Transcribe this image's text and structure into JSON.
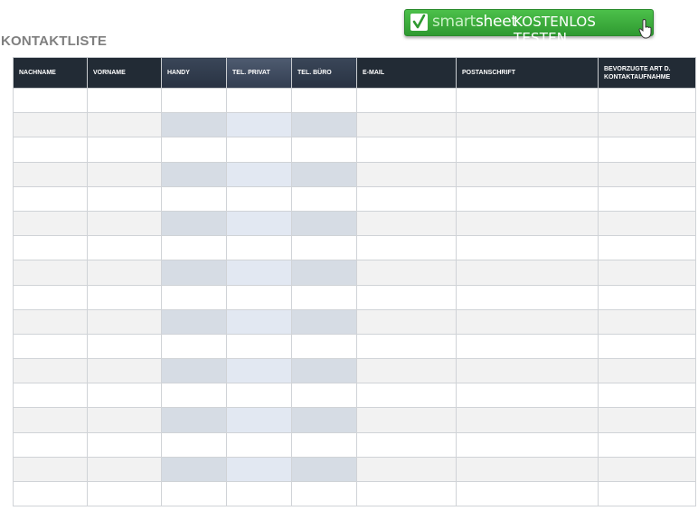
{
  "page": {
    "title": "KONTAKTLISTE"
  },
  "promo": {
    "brand_prefix": "smart",
    "brand_suffix": "sheet",
    "cta": "KOSTENLOS TESTEN",
    "color": "#3aad3b"
  },
  "table": {
    "columns": [
      {
        "key": "nachname",
        "label": "NACHNAME"
      },
      {
        "key": "vorname",
        "label": "VORNAME"
      },
      {
        "key": "handy",
        "label": "HANDY"
      },
      {
        "key": "privat",
        "label": "TEL. PRIVAT"
      },
      {
        "key": "buero",
        "label": "TEL. BÜRO"
      },
      {
        "key": "email",
        "label": "E-MAIL"
      },
      {
        "key": "post",
        "label": "POSTANSCHRIFT"
      },
      {
        "key": "kontakt",
        "label": "BEVORZUGTE ART D. KONTAKTAUFNAHME"
      }
    ],
    "rows": [
      [
        "",
        "",
        "",
        "",
        "",
        "",
        "",
        ""
      ],
      [
        "",
        "",
        "",
        "",
        "",
        "",
        "",
        ""
      ],
      [
        "",
        "",
        "",
        "",
        "",
        "",
        "",
        ""
      ],
      [
        "",
        "",
        "",
        "",
        "",
        "",
        "",
        ""
      ],
      [
        "",
        "",
        "",
        "",
        "",
        "",
        "",
        ""
      ],
      [
        "",
        "",
        "",
        "",
        "",
        "",
        "",
        ""
      ],
      [
        "",
        "",
        "",
        "",
        "",
        "",
        "",
        ""
      ],
      [
        "",
        "",
        "",
        "",
        "",
        "",
        "",
        ""
      ],
      [
        "",
        "",
        "",
        "",
        "",
        "",
        "",
        ""
      ],
      [
        "",
        "",
        "",
        "",
        "",
        "",
        "",
        ""
      ],
      [
        "",
        "",
        "",
        "",
        "",
        "",
        "",
        ""
      ],
      [
        "",
        "",
        "",
        "",
        "",
        "",
        "",
        ""
      ],
      [
        "",
        "",
        "",
        "",
        "",
        "",
        "",
        ""
      ],
      [
        "",
        "",
        "",
        "",
        "",
        "",
        "",
        ""
      ],
      [
        "",
        "",
        "",
        "",
        "",
        "",
        "",
        ""
      ],
      [
        "",
        "",
        "",
        "",
        "",
        "",
        "",
        ""
      ],
      [
        "",
        "",
        "",
        "",
        "",
        "",
        "",
        ""
      ]
    ],
    "header_color": "#222b35",
    "stripe_color": "#f2f2f2",
    "phone_stripe_color": "#d6dce4"
  }
}
